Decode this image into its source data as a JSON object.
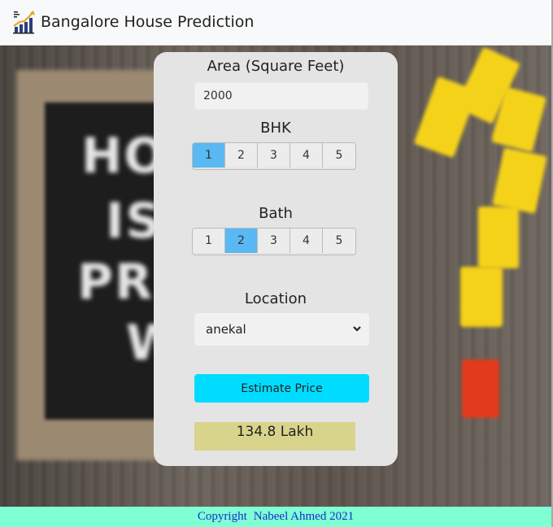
{
  "header": {
    "title": "Bangalore House Prediction",
    "logo_icon": "growth-chart-icon"
  },
  "form": {
    "area": {
      "label": "Area (Square Feet)",
      "value": "2000"
    },
    "bhk": {
      "label": "BHK",
      "options": [
        "1",
        "2",
        "3",
        "4",
        "5"
      ],
      "selected": "1"
    },
    "bath": {
      "label": "Bath",
      "options": [
        "1",
        "2",
        "3",
        "4",
        "5"
      ],
      "selected": "2"
    },
    "location": {
      "label": "Location",
      "selected": "anekal"
    },
    "estimate_button": "Estimate Price",
    "result": "134.8 Lakh"
  },
  "footer": {
    "copyright": "Copyright",
    "author_year": "Nabeel Ahmed 2021"
  },
  "colors": {
    "accent_button": "#00dcff",
    "selected_segment": "#5ab8f2",
    "result_bg": "#d8d48c",
    "footer_bg": "#7fffd4",
    "footer_text": "#1a2bd0"
  }
}
